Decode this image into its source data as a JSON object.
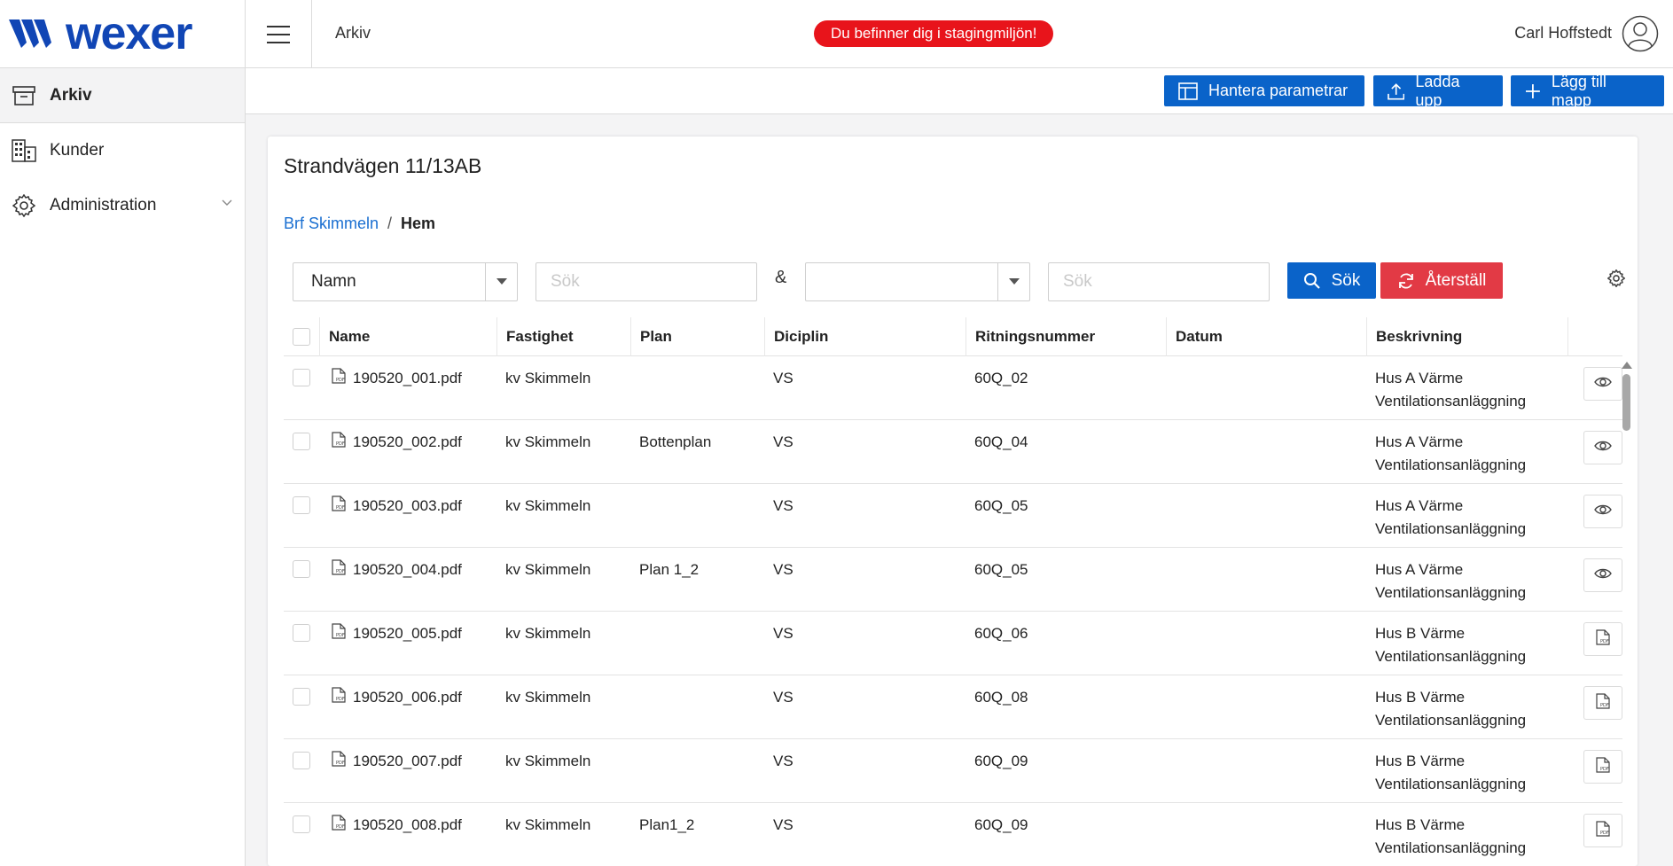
{
  "brand": {
    "name": "wexer",
    "color": "#1146b5"
  },
  "sidebar": {
    "items": [
      {
        "label": "Arkiv",
        "icon": "archive-icon",
        "active": true
      },
      {
        "label": "Kunder",
        "icon": "building-icon",
        "active": false
      },
      {
        "label": "Administration",
        "icon": "gear-icon",
        "active": false,
        "expandable": true
      }
    ]
  },
  "topbar": {
    "title": "Arkiv",
    "staging_badge": "Du befinner dig i stagingmiljön!",
    "user_name": "Carl Hoffstedt"
  },
  "actions": {
    "manage_params": "Hantera parametrar",
    "upload": "Ladda upp",
    "add_folder": "Lägg till mapp"
  },
  "card": {
    "title": "Strandvägen 11/13AB",
    "breadcrumb": {
      "parent": "Brf Skimmeln",
      "separator": "/",
      "current": "Hem"
    }
  },
  "filters": {
    "field1_value": "Namn",
    "search1_placeholder": "Sök",
    "joiner": "&",
    "field2_value": "",
    "search2_placeholder": "Sök",
    "search_button": "Sök",
    "reset_button": "Återställ"
  },
  "table": {
    "columns": [
      "Name",
      "Fastighet",
      "Plan",
      "Diciplin",
      "Ritningsnummer",
      "Datum",
      "Beskrivning"
    ],
    "rows": [
      {
        "name": "190520_001.pdf",
        "fastighet": "kv Skimmeln",
        "plan": "",
        "diciplin": "VS",
        "ritningsnummer": "60Q_02",
        "datum": "",
        "beskrivning1": "Hus A Värme",
        "beskrivning2": "Ventilationsanläggning",
        "action": "eye-icon"
      },
      {
        "name": "190520_002.pdf",
        "fastighet": "kv Skimmeln",
        "plan": "Bottenplan",
        "diciplin": "VS",
        "ritningsnummer": "60Q_04",
        "datum": "",
        "beskrivning1": "Hus A Värme",
        "beskrivning2": "Ventilationsanläggning",
        "action": "eye-icon"
      },
      {
        "name": "190520_003.pdf",
        "fastighet": "kv Skimmeln",
        "plan": "",
        "diciplin": "VS",
        "ritningsnummer": "60Q_05",
        "datum": "",
        "beskrivning1": "Hus A Värme",
        "beskrivning2": "Ventilationsanläggning",
        "action": "eye-icon"
      },
      {
        "name": "190520_004.pdf",
        "fastighet": "kv Skimmeln",
        "plan": "Plan 1_2",
        "diciplin": "VS",
        "ritningsnummer": "60Q_05",
        "datum": "",
        "beskrivning1": "Hus A Värme",
        "beskrivning2": "Ventilationsanläggning",
        "action": "eye-icon"
      },
      {
        "name": "190520_005.pdf",
        "fastighet": "kv Skimmeln",
        "plan": "",
        "diciplin": "VS",
        "ritningsnummer": "60Q_06",
        "datum": "",
        "beskrivning1": "Hus B Värme",
        "beskrivning2": "Ventilationsanläggning",
        "action": "pdf-icon"
      },
      {
        "name": "190520_006.pdf",
        "fastighet": "kv Skimmeln",
        "plan": "",
        "diciplin": "VS",
        "ritningsnummer": "60Q_08",
        "datum": "",
        "beskrivning1": "Hus B Värme",
        "beskrivning2": "Ventilationsanläggning",
        "action": "pdf-icon"
      },
      {
        "name": "190520_007.pdf",
        "fastighet": "kv Skimmeln",
        "plan": "",
        "diciplin": "VS",
        "ritningsnummer": "60Q_09",
        "datum": "",
        "beskrivning1": "Hus B Värme",
        "beskrivning2": "Ventilationsanläggning",
        "action": "pdf-icon"
      },
      {
        "name": "190520_008.pdf",
        "fastighet": "kv Skimmeln",
        "plan": "Plan1_2",
        "diciplin": "VS",
        "ritningsnummer": "60Q_09",
        "datum": "",
        "beskrivning1": "Hus B Värme",
        "beskrivning2": "Ventilationsanläggning",
        "action": "pdf-icon"
      }
    ]
  },
  "colors": {
    "primary": "#0a63c9",
    "danger": "#e23a45",
    "staging": "#e8141b",
    "link": "#1a6fd1"
  }
}
